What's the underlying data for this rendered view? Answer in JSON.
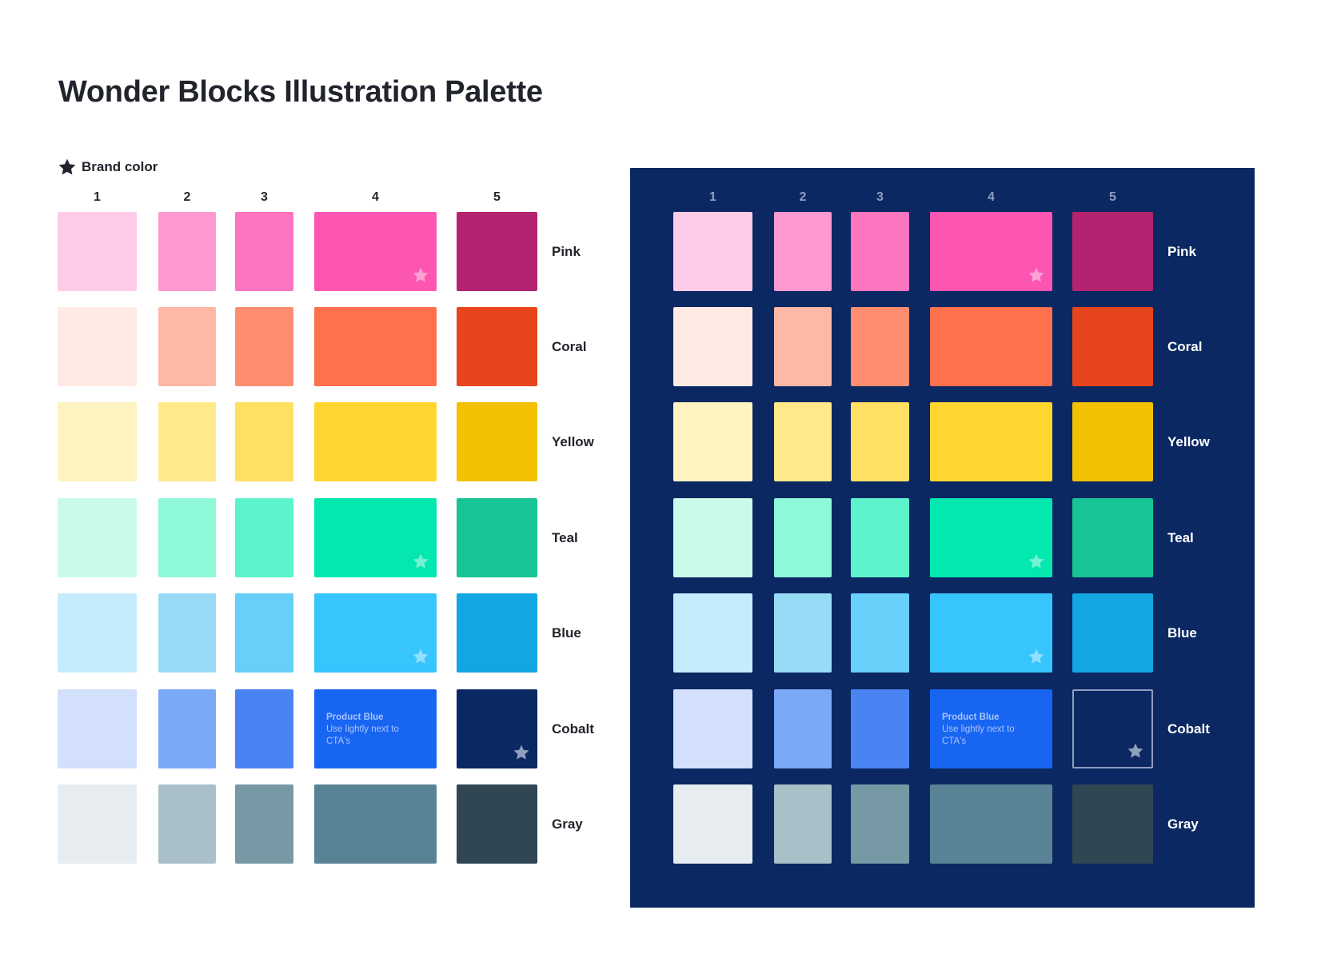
{
  "title": "Wonder Blocks Illustration Palette",
  "legend": {
    "label": "Brand color",
    "icon": "star-icon"
  },
  "columns": [
    "1",
    "2",
    "3",
    "4",
    "5"
  ],
  "rows": [
    {
      "name": "Pink",
      "colors": [
        "#fecbe8",
        "#fd99d0",
        "#fd74bf",
        "#fc55b2",
        "#b3236f"
      ],
      "star": 3
    },
    {
      "name": "Coral",
      "colors": [
        "#ffebe4",
        "#ffb8a5",
        "#ff8d70",
        "#ff704c",
        "#e7451e"
      ],
      "star": null
    },
    {
      "name": "Yellow",
      "colors": [
        "#fff3c1",
        "#ffe98a",
        "#ffe063",
        "#ffd630",
        "#f3c102"
      ],
      "star": null
    },
    {
      "name": "Teal",
      "colors": [
        "#cafbea",
        "#8ef8d9",
        "#5cf4cc",
        "#03e8ae",
        "#16c495"
      ],
      "star": 3
    },
    {
      "name": "Blue",
      "colors": [
        "#c5ecfd",
        "#98dbf6",
        "#66cffa",
        "#37c5fd",
        "#12a6e3"
      ],
      "star": 3
    },
    {
      "name": "Cobalt",
      "colors": [
        "#d3e0fc",
        "#7ba8f7",
        "#4a83f2",
        "#1865f2",
        "#0b2862"
      ],
      "star": 4
    },
    {
      "name": "Gray",
      "colors": [
        "#e7ecf0",
        "#a9c0c9",
        "#7799a6",
        "#588394",
        "#304653"
      ],
      "star": null
    }
  ],
  "product_blue_note": {
    "title": "Product Blue",
    "body": "Use lightly next to CTA's"
  },
  "brand_star_color_light": "#ffffff",
  "dark_background": "#0b2862"
}
